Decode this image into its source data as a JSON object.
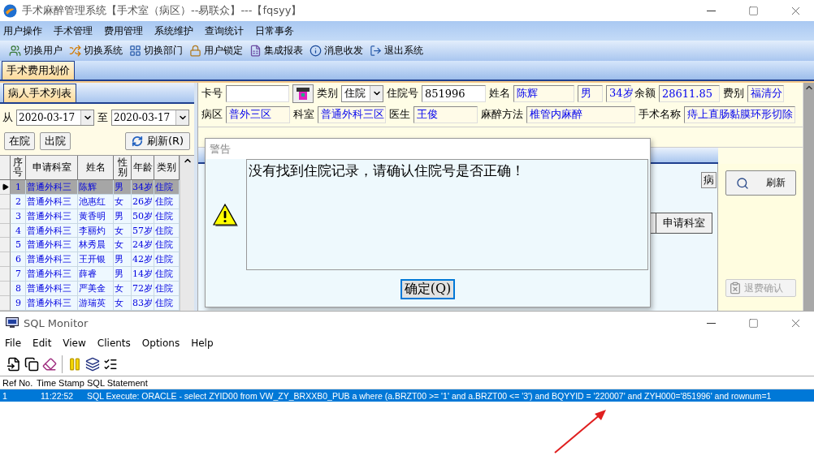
{
  "window": {
    "title": "手术麻醉管理系统【手术室（病区）--易联众】---【fqsyy】"
  },
  "menu": [
    "用户操作",
    "手术管理",
    "费用管理",
    "系统维护",
    "查询统计",
    "日常事务"
  ],
  "toolbar": [
    {
      "label": "切换用户",
      "kind": "users"
    },
    {
      "label": "切换系统",
      "kind": "system"
    },
    {
      "label": "切换部门",
      "kind": "department"
    },
    {
      "label": "用户锁定",
      "kind": "lock"
    },
    {
      "label": "集成报表",
      "kind": "report"
    },
    {
      "label": "消息收发",
      "kind": "message"
    },
    {
      "label": "退出系统",
      "kind": "exit"
    }
  ],
  "tabs": [
    {
      "label": "手术费用划价",
      "selected": true
    }
  ],
  "patient_list": {
    "tabs": [
      {
        "label": "病人手术列表",
        "selected": true
      }
    ],
    "from_label": "从",
    "date_from": "2020-03-17",
    "to_label": "至",
    "date_to": "2020-03-17",
    "buttons": [
      {
        "label": "在院",
        "kind": "plain"
      },
      {
        "label": "出院",
        "kind": "plain"
      },
      {
        "label": "刷新(R)",
        "kind": "refresh"
      }
    ],
    "columns": [
      "序号",
      "申请科室",
      "姓名",
      "性别",
      "年龄",
      "类别"
    ],
    "rows": [
      {
        "cells": [
          "1",
          "普通外科三",
          "陈辉",
          "男",
          "34岁",
          "住院"
        ],
        "selected": true
      },
      {
        "cells": [
          "2",
          "普通外科三",
          "池惠红",
          "女",
          "26岁",
          "住院"
        ],
        "selected": false
      },
      {
        "cells": [
          "3",
          "普通外科三",
          "黄香明",
          "男",
          "50岁",
          "住院"
        ],
        "selected": false
      },
      {
        "cells": [
          "4",
          "普通外科三",
          "李丽灼",
          "女",
          "57岁",
          "住院"
        ],
        "selected": false
      },
      {
        "cells": [
          "5",
          "普通外科三",
          "林秀晨",
          "女",
          "24岁",
          "住院"
        ],
        "selected": false
      },
      {
        "cells": [
          "6",
          "普通外科三",
          "王开银",
          "男",
          "42岁",
          "住院"
        ],
        "selected": false
      },
      {
        "cells": [
          "7",
          "普通外科三",
          "薛睿",
          "男",
          "14岁",
          "住院"
        ],
        "selected": false
      },
      {
        "cells": [
          "8",
          "普通外科三",
          "严美金",
          "女",
          "72岁",
          "住院"
        ],
        "selected": false
      },
      {
        "cells": [
          "9",
          "普通外科三",
          "游瑞英",
          "女",
          "83岁",
          "住院"
        ],
        "selected": false
      }
    ]
  },
  "patient_form": {
    "first_line": [
      {
        "kind": "label",
        "text": "卡号"
      },
      {
        "kind": "input"
      },
      {
        "kind": "card-button"
      },
      {
        "kind": "label",
        "text": "类别"
      },
      {
        "kind": "select",
        "value": "住院"
      },
      {
        "kind": "label",
        "text": "住院号"
      },
      {
        "kind": "input",
        "value": "851996"
      },
      {
        "kind": "label",
        "text": "姓名"
      },
      {
        "kind": "readonly",
        "value": "陈辉"
      },
      {
        "kind": "readonly",
        "value": "男"
      },
      {
        "kind": "readonly",
        "value": "34岁"
      },
      {
        "kind": "label",
        "text": "余额"
      },
      {
        "kind": "readonly",
        "value": "28611.85"
      },
      {
        "kind": "label",
        "text": "费别"
      },
      {
        "kind": "readonly",
        "value": "福清分"
      }
    ],
    "second_line": [
      {
        "kind": "label",
        "text": "病区"
      },
      {
        "kind": "readonly",
        "value": "普外三区"
      },
      {
        "kind": "label",
        "text": "科室"
      },
      {
        "kind": "readonly",
        "value": "普通外科三区"
      },
      {
        "kind": "label",
        "text": "医生"
      },
      {
        "kind": "readonly",
        "value": "王俊"
      },
      {
        "kind": "label",
        "text": "麻醉方法"
      },
      {
        "kind": "readonly",
        "value": "椎管内麻醉"
      },
      {
        "kind": "label",
        "text": "手术名称"
      },
      {
        "kind": "readonly",
        "value": "痔上直肠黏膜环形切除"
      }
    ]
  },
  "detail": {
    "band_button": "病",
    "columns": [
      "申请科室"
    ]
  },
  "side_buttons": [
    {
      "label": "刷新",
      "kind": "search",
      "disabled": false
    },
    {
      "label": "退费确认",
      "kind": "refund",
      "disabled": true
    }
  ],
  "dialog": {
    "title": "警告",
    "message": "没有找到住院记录，请确认住院号是否正确！",
    "button": "确定(Q)"
  },
  "sql_monitor": {
    "title": "SQL Monitor",
    "menu": [
      "File",
      "Edit",
      "View",
      "Clients",
      "Options",
      "Help"
    ],
    "columns": [
      "Ref No.",
      "Time Stamp",
      "SQL Statement"
    ],
    "rows": [
      {
        "ref": "1",
        "time": "11:22:52",
        "statement": "SQL Execute: ORACLE - select ZYID00 from VW_ZY_BRXXB0_PUB a where (a.BRZT00 >= '1' and a.BRZT00 <= '3') and BQYYID = '220007' and ZYH000='851996' and rownum=1",
        "selected": true
      }
    ]
  }
}
